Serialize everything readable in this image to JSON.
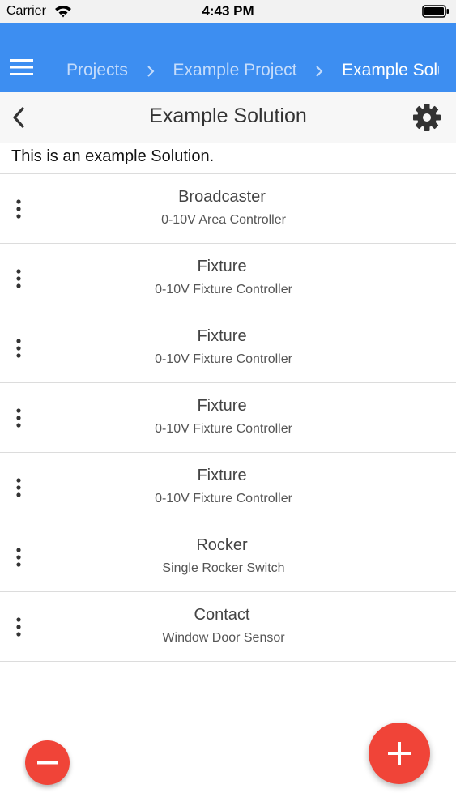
{
  "status_bar": {
    "carrier": "Carrier",
    "time": "4:43 PM",
    "icons": [
      "wifi-icon",
      "battery-icon"
    ]
  },
  "app_bar": {
    "color": "#3d8ef1",
    "menu_icon": "hamburger-menu-icon",
    "breadcrumb": [
      "Projects",
      "Example Project",
      "Example Solu"
    ]
  },
  "title_bar": {
    "back_icon": "chevron-left-icon",
    "title": "Example Solution",
    "settings_icon": "gear-icon"
  },
  "description": "This is an example Solution.",
  "devices": [
    {
      "name": "Broadcaster",
      "type": "0-10V Area Controller"
    },
    {
      "name": "Fixture",
      "type": "0-10V Fixture Controller"
    },
    {
      "name": "Fixture",
      "type": "0-10V Fixture Controller"
    },
    {
      "name": "Fixture",
      "type": "0-10V Fixture Controller"
    },
    {
      "name": "Fixture",
      "type": "0-10V Fixture Controller"
    },
    {
      "name": "Rocker",
      "type": "Single Rocker Switch"
    },
    {
      "name": "Contact",
      "type": "Window Door Sensor"
    }
  ],
  "actions": {
    "remove_icon": "minus-icon",
    "add_icon": "plus-icon",
    "accent_color": "#f04438"
  }
}
